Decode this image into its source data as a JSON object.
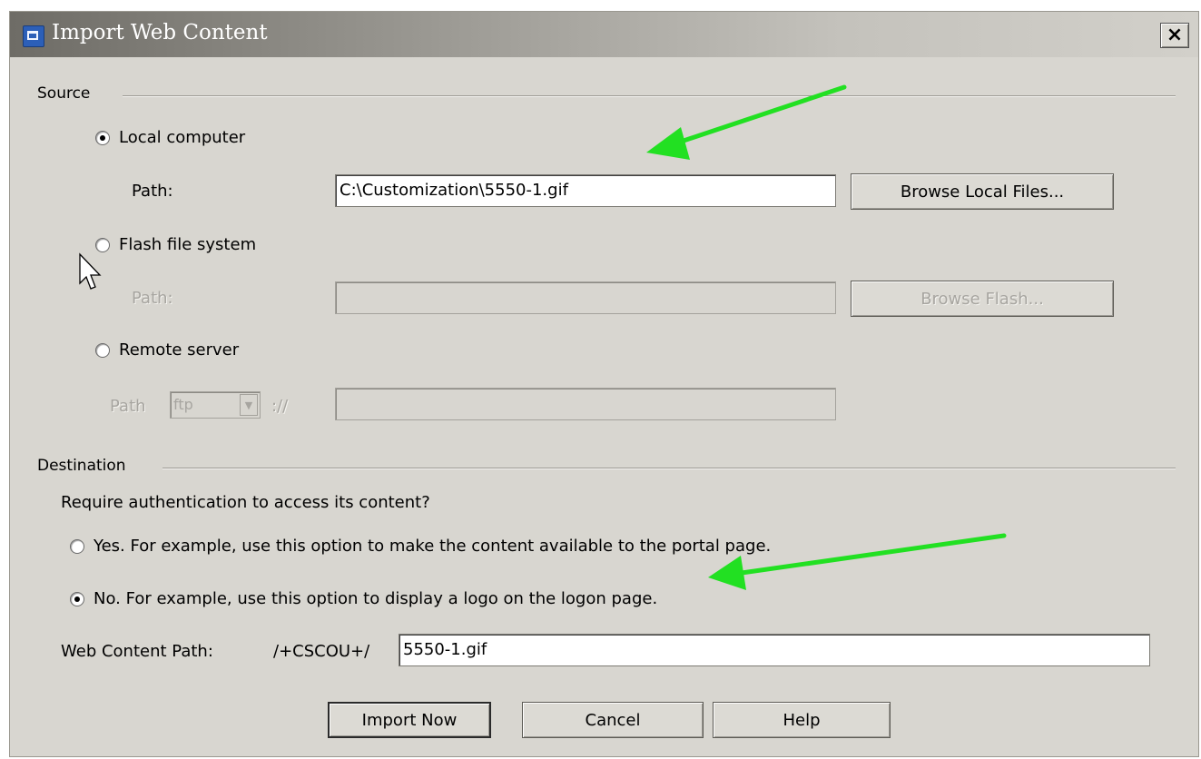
{
  "window": {
    "title": "Import Web Content",
    "close_label": "×"
  },
  "source": {
    "group_label": "Source",
    "local": {
      "label": "Local computer",
      "checked": true,
      "path_label": "Path:",
      "path_value": "C:\\Customization\\5550-1.gif",
      "browse_label": "Browse Local Files..."
    },
    "flash": {
      "label": "Flash file system",
      "checked": false,
      "path_label": "Path:",
      "path_value": "",
      "browse_label": "Browse Flash..."
    },
    "remote": {
      "label": "Remote server",
      "checked": false,
      "path_label": "Path",
      "protocol": "ftp",
      "separator": "://",
      "url_value": ""
    }
  },
  "destination": {
    "group_label": "Destination",
    "question": "Require authentication to access its content?",
    "yes_label": "Yes. For example, use this option to make the content available to the portal page.",
    "no_label": "No. For example, use this option to display a logo on the logon page.",
    "yes_checked": false,
    "no_checked": true,
    "web_path_label": "Web Content Path:",
    "web_path_prefix": "/+CSCOU+/",
    "web_path_value": "5550-1.gif"
  },
  "buttons": {
    "import": "Import Now",
    "cancel": "Cancel",
    "help": "Help"
  },
  "annotations": {
    "arrow_color": "#22e022"
  }
}
